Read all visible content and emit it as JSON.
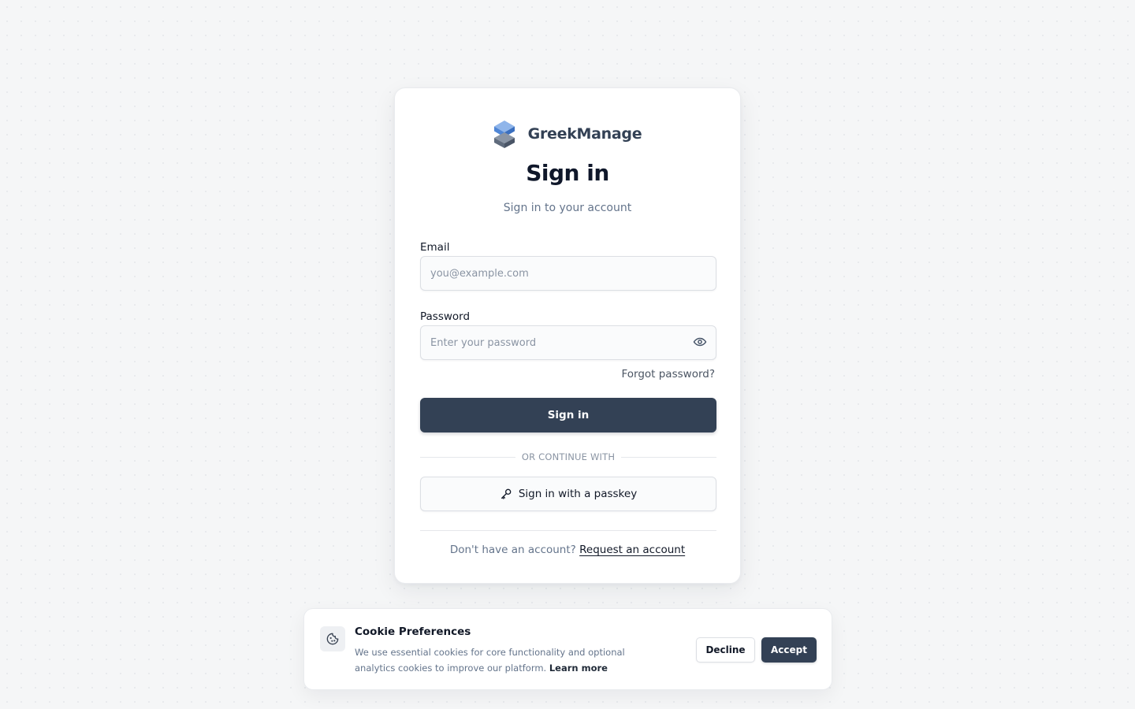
{
  "brand": {
    "name": "GreekManage",
    "logo_icon": "stacked-cubes-logo"
  },
  "signin": {
    "title": "Sign in",
    "subtitle": "Sign in to your account",
    "email_label": "Email",
    "email_placeholder": "you@example.com",
    "password_label": "Password",
    "password_placeholder": "Enter your password",
    "forgot_label": "Forgot password?",
    "submit_label": "Sign in",
    "divider_label": "OR CONTINUE WITH",
    "passkey_label": "Sign in with a passkey",
    "no_account_text": "Don't have an account?",
    "request_link": "Request an account"
  },
  "cookie": {
    "title": "Cookie Preferences",
    "text": "We use essential cookies for core functionality and optional analytics cookies to improve our platform.",
    "learn_more": "Learn more",
    "decline_label": "Decline",
    "accept_label": "Accept"
  },
  "colors": {
    "primary": "#334155",
    "logo_top": "#5b8fd9",
    "logo_bottom": "#5f6b7c",
    "background": "#f5f6f7"
  }
}
